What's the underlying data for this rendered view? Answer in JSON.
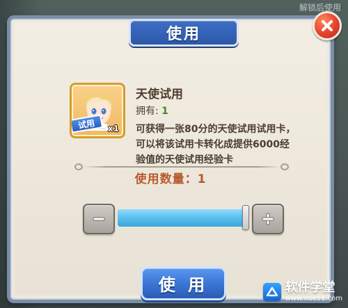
{
  "background": {
    "hint_text": "解锁后使用"
  },
  "dialog": {
    "title": "使用",
    "close_icon": "close-x-icon",
    "item": {
      "name": "天使试用",
      "owned_label": "拥有:",
      "owned_value": "1",
      "ribbon_label": "试用",
      "count_text": "x1",
      "description": "可获得一张80分的天使试用试用卡，可以将该试用卡转化成提供6000经验值的天使试用经验卡"
    },
    "quantity_label": "使用数量：1",
    "slider": {
      "minus_icon": "minus-icon",
      "plus_icon": "plus-icon",
      "fill_fraction": 1
    },
    "use_button_label": "使 用"
  },
  "watermark": {
    "name": "软件学堂",
    "url": "www.xue51.com"
  },
  "colors": {
    "panel_bg": "#efe9dd",
    "panel_border": "#7c8ea8",
    "title_blue": "#2c58a8",
    "close_red": "#e2422d",
    "accent_orange": "#b75a2c",
    "owned_green": "#3d8a2a",
    "slider_fill": "#58bfed"
  }
}
